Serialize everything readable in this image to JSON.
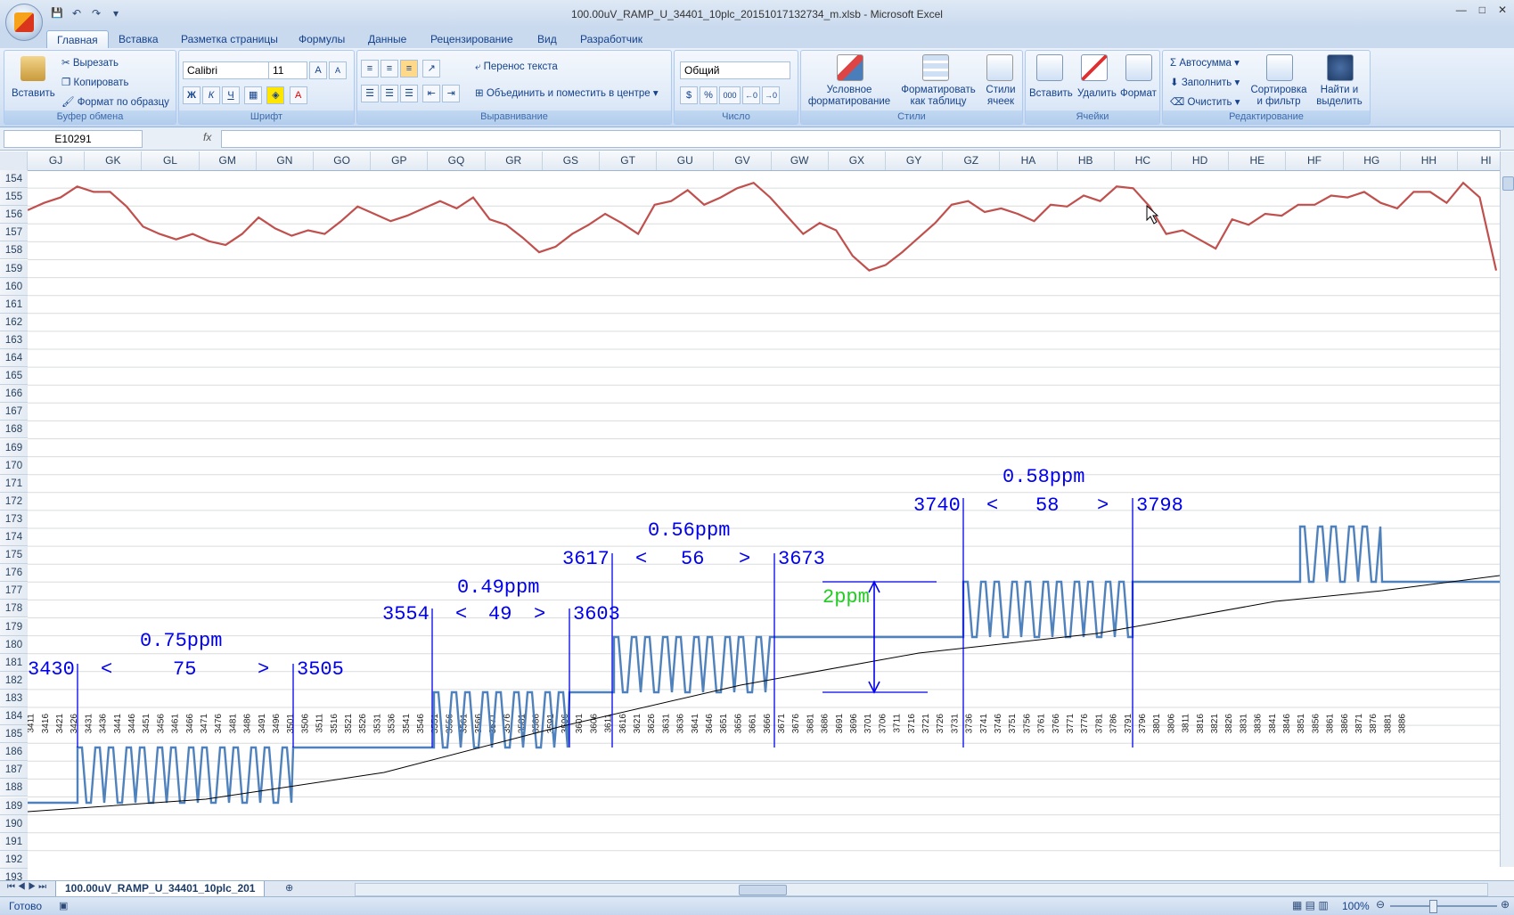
{
  "window": {
    "title": "100.00uV_RAMP_U_34401_10plc_20151017132734_m.xlsb - Microsoft Excel",
    "controls": [
      "—",
      "□",
      "✕"
    ]
  },
  "qat": {
    "save": "💾",
    "undo": "↶",
    "redo": "↷",
    "customize": "▾"
  },
  "tabs": [
    "Главная",
    "Вставка",
    "Разметка страницы",
    "Формулы",
    "Данные",
    "Рецензирование",
    "Вид",
    "Разработчик"
  ],
  "ribbon": {
    "clipboard": {
      "label": "Буфер обмена",
      "paste": "Вставить",
      "cut": "Вырезать",
      "copy": "Копировать",
      "format_painter": "Формат по образцу"
    },
    "font": {
      "label": "Шрифт",
      "name": "Calibri",
      "size": "11",
      "bold": "Ж",
      "italic": "К",
      "underline": "Ч",
      "grow": "A",
      "shrink": "A"
    },
    "alignment": {
      "label": "Выравнивание",
      "wrap": "Перенос текста",
      "merge": "Объединить и поместить в центре"
    },
    "number": {
      "label": "Число",
      "format": "Общий",
      "percent": "%",
      "thousands": "000"
    },
    "styles": {
      "label": "Стили",
      "conditional": "Условное форматирование",
      "as_table": "Форматировать как таблицу",
      "cell_styles": "Стили ячеек"
    },
    "cells": {
      "label": "Ячейки",
      "insert": "Вставить",
      "delete": "Удалить",
      "format": "Формат"
    },
    "editing": {
      "label": "Редактирование",
      "autosum": "Автосумма",
      "fill": "Заполнить",
      "clear": "Очистить",
      "sort": "Сортировка и фильтр",
      "find": "Найти и выделить"
    }
  },
  "formula_bar": {
    "name_box": "E10291",
    "fx": "fx",
    "content": ""
  },
  "columns": [
    "GJ",
    "GK",
    "GL",
    "GM",
    "GN",
    "GO",
    "GP",
    "GQ",
    "GR",
    "GS",
    "GT",
    "GU",
    "GV",
    "GW",
    "GX",
    "GY",
    "GZ",
    "HA",
    "HB",
    "HC",
    "HD",
    "HE",
    "HF",
    "HG",
    "HH",
    "HI"
  ],
  "rows": [
    "154",
    "155",
    "156",
    "157",
    "158",
    "159",
    "160",
    "161",
    "162",
    "163",
    "164",
    "165",
    "166",
    "167",
    "168",
    "169",
    "170",
    "171",
    "172",
    "173",
    "174",
    "175",
    "176",
    "177",
    "178",
    "179",
    "180",
    "181",
    "182",
    "183",
    "184",
    "185",
    "186",
    "187",
    "188",
    "189",
    "190",
    "191",
    "192",
    "193"
  ],
  "chart_data": [
    {
      "type": "line",
      "title": "",
      "xlim": [
        3411,
        3886
      ],
      "ylim": [
        154,
        159
      ],
      "series": [
        {
          "color": "#c0504d",
          "values_y": [
            155.7,
            155.3,
            155.0,
            154.4,
            154.7,
            154.7,
            155.5,
            156.6,
            157.0,
            157.3,
            157.0,
            157.4,
            157.6,
            157.0,
            156.1,
            156.7,
            157.1,
            156.8,
            157.0,
            156.3,
            155.5,
            155.9,
            156.3,
            156.0,
            155.6,
            155.2,
            155.6,
            155.0,
            156.2,
            156.5,
            157.2,
            158.0,
            157.7,
            157.0,
            156.5,
            155.9,
            156.4,
            157.0,
            155.4,
            155.2,
            154.6,
            155.4,
            155.0,
            154.5,
            154.2,
            155.0,
            156.0,
            157.0,
            156.4,
            156.8,
            158.2,
            159.0,
            158.7,
            158.0,
            157.2,
            156.4,
            155.4,
            155.2,
            155.8,
            155.6,
            155.9,
            156.3,
            155.4,
            155.5,
            154.9,
            155.2,
            154.4,
            154.5,
            155.5,
            157.0,
            156.8,
            157.3,
            157.8,
            156.2,
            156.5,
            155.9,
            156.0,
            155.4,
            155.4,
            154.9,
            155.0,
            154.7,
            155.3,
            155.6,
            154.7,
            154.7,
            155.3,
            154.2,
            155.0,
            159.0
          ]
        }
      ],
      "note": ""
    },
    {
      "type": "line",
      "x_ticks": [
        "3411",
        "3416",
        "3421",
        "3426",
        "3431",
        "3436",
        "3441",
        "3446",
        "3451",
        "3456",
        "3461",
        "3466",
        "3471",
        "3476",
        "3481",
        "3486",
        "3491",
        "3496",
        "3501",
        "3506",
        "3511",
        "3516",
        "3521",
        "3526",
        "3531",
        "3536",
        "3541",
        "3546",
        "3551",
        "3556",
        "3561",
        "3566",
        "3571",
        "3576",
        "3581",
        "3586",
        "3591",
        "3596",
        "3601",
        "3606",
        "3611",
        "3616",
        "3621",
        "3626",
        "3631",
        "3636",
        "3641",
        "3646",
        "3651",
        "3656",
        "3661",
        "3666",
        "3671",
        "3676",
        "3681",
        "3686",
        "3691",
        "3696",
        "3701",
        "3706",
        "3711",
        "3716",
        "3721",
        "3726",
        "3731",
        "3736",
        "3741",
        "3746",
        "3751",
        "3756",
        "3761",
        "3766",
        "3771",
        "3776",
        "3781",
        "3786",
        "3791",
        "3796",
        "3801",
        "3806",
        "3811",
        "3816",
        "3821",
        "3826",
        "3831",
        "3836",
        "3841",
        "3846",
        "3851",
        "3856",
        "3861",
        "3866",
        "3871",
        "3876",
        "3881",
        "3886"
      ],
      "annotations": [
        {
          "ppm": "0.75ppm",
          "start": "3430",
          "lt": "<",
          "count": "75",
          "gt": ">",
          "end": "3505"
        },
        {
          "ppm": "0.49ppm",
          "start": "3554",
          "lt": "<",
          "count": "49",
          "gt": ">",
          "end": "3603"
        },
        {
          "ppm": "0.56ppm",
          "start": "3617",
          "lt": "<",
          "count": "56",
          "gt": ">",
          "end": "3673"
        },
        {
          "ppm": "0.58ppm",
          "start": "3740",
          "lt": "<",
          "count": "58",
          "gt": ">",
          "end": "3798"
        }
      ],
      "scale_label": "2ppm",
      "series": [
        {
          "color": "#4f81bd",
          "kind": "step-noise"
        },
        {
          "color": "#000000",
          "kind": "trend"
        }
      ]
    }
  ],
  "sheet_tab": "100.00uV_RAMP_U_34401_10plc_201",
  "status": {
    "ready": "Готово",
    "zoom": "100%"
  }
}
